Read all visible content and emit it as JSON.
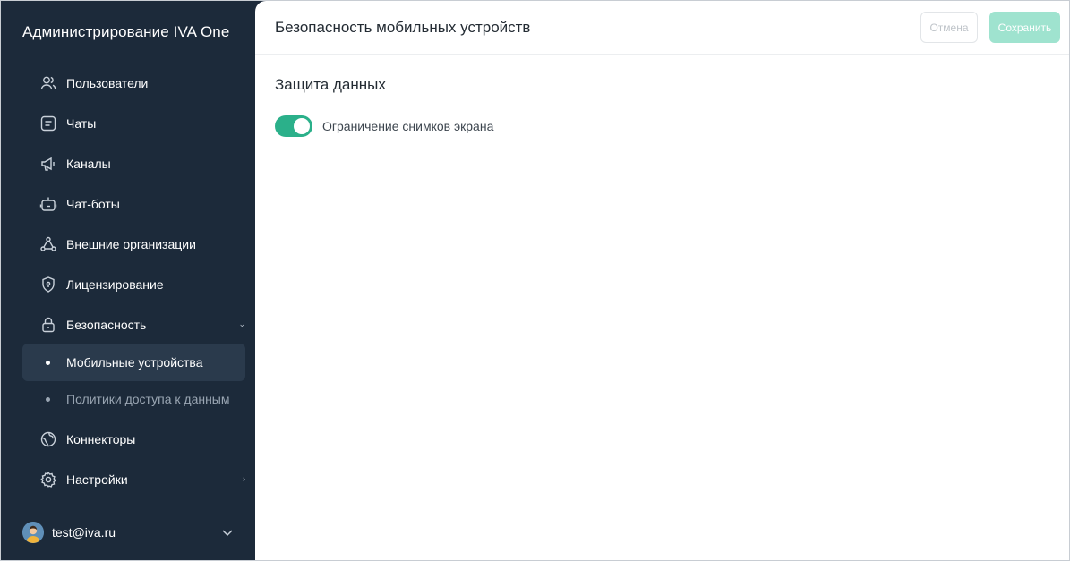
{
  "sidebar": {
    "title": "Администрирование IVA One",
    "items": [
      {
        "label": "Пользователи",
        "icon": "users-icon"
      },
      {
        "label": "Чаты",
        "icon": "chat-icon"
      },
      {
        "label": "Каналы",
        "icon": "megaphone-icon"
      },
      {
        "label": "Чат-боты",
        "icon": "bot-icon"
      },
      {
        "label": "Внешние организации",
        "icon": "organizations-icon"
      },
      {
        "label": "Лицензирование",
        "icon": "license-shield-icon"
      },
      {
        "label": "Безопасность",
        "icon": "lock-icon",
        "expanded": true
      },
      {
        "label": "Коннекторы",
        "icon": "globe-icon"
      },
      {
        "label": "Настройки",
        "icon": "gear-icon"
      }
    ],
    "security_subitems": [
      {
        "label": "Мобильные устройства",
        "active": true
      },
      {
        "label": "Политики доступа к данным",
        "active": false
      }
    ],
    "user": {
      "email": "test@iva.ru"
    }
  },
  "header": {
    "title": "Безопасность мобильных устройств",
    "cancel_label": "Отмена",
    "save_label": "Сохранить"
  },
  "content": {
    "section_title": "Защита данных",
    "toggle": {
      "label": "Ограничение снимков экрана",
      "on": true
    }
  },
  "colors": {
    "sidebar_bg": "#1c2a3a",
    "active_item_bg": "#2a3a4c",
    "accent": "#2bb08a",
    "save_disabled": "#9fe3cf"
  }
}
